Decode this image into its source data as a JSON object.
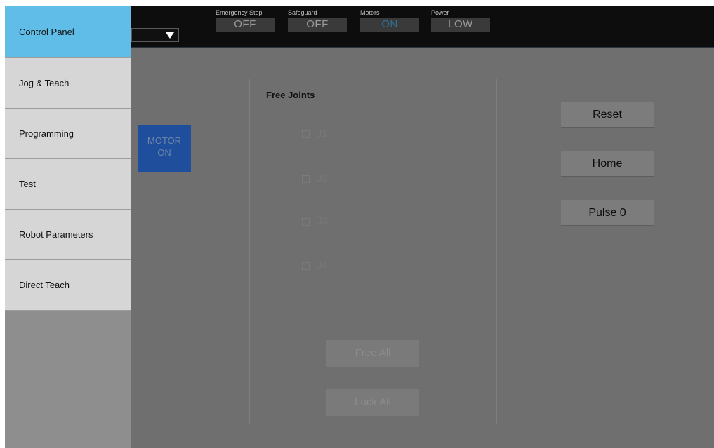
{
  "topbar": {
    "status": [
      {
        "label": "Emergency Stop",
        "value": "OFF"
      },
      {
        "label": "Safeguard",
        "value": "OFF"
      },
      {
        "label": "Motors",
        "value": "ON"
      },
      {
        "label": "Power",
        "value": "LOW"
      }
    ]
  },
  "sidebar": {
    "items": [
      {
        "label": "Control Panel"
      },
      {
        "label": "Jog & Teach"
      },
      {
        "label": "Programming"
      },
      {
        "label": "Test"
      },
      {
        "label": "Robot Parameters"
      },
      {
        "label": "Direct Teach"
      }
    ]
  },
  "main": {
    "motor_button": {
      "line1": "MOTOR",
      "line2": "ON"
    },
    "free_joints": {
      "title": "Free Joints",
      "joints": [
        "J1",
        "J2",
        "J3",
        "J4"
      ],
      "free_all_label": "Free All",
      "lock_all_label": "Lock All"
    },
    "actions": {
      "reset_label": "Reset",
      "home_label": "Home",
      "pulse_label": "Pulse 0"
    }
  },
  "colors": {
    "active_tab": "#5fbde7",
    "motor_button": "#1f4f9c",
    "motors_on_text": "#2f6f92"
  }
}
